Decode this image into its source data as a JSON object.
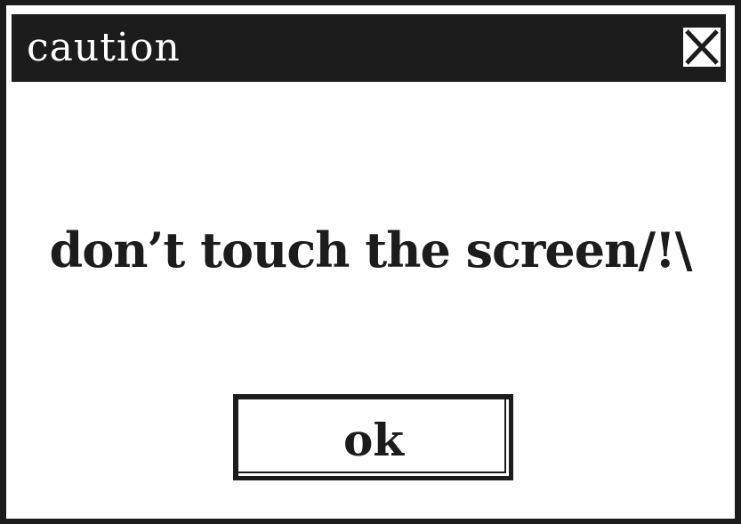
{
  "dialog": {
    "title": "caution",
    "close_icon": "close-icon",
    "message": "don’t touch the screen/!\\",
    "ok_label": "ok"
  },
  "colors": {
    "frame": "#1c1c1c",
    "background": "#ffffff",
    "title_text": "#ffffff",
    "body_text": "#1c1c1c"
  }
}
